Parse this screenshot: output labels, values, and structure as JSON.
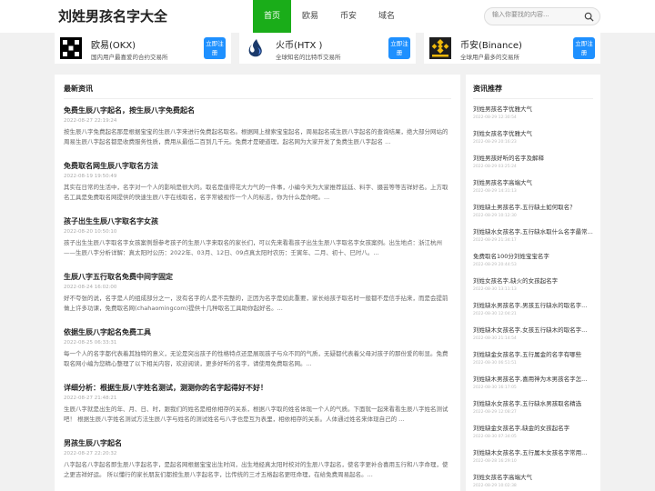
{
  "header": {
    "logo": "刘姓男孩名字大全",
    "nav": [
      "首页",
      "欧易",
      "币安",
      "域名"
    ],
    "search_placeholder": "输入你要找的内容..."
  },
  "exchanges": [
    {
      "name": "欧易(OKX)",
      "desc": "国内用户最喜爱的合约交易所",
      "btn": "立即注册",
      "icon": "okx-logo-icon"
    },
    {
      "name": "火币(HTX )",
      "desc": "全球知名的比特币交易所",
      "btn": "立即注册",
      "icon": "htx-logo-icon"
    },
    {
      "name": "币安(Binance)",
      "desc": "全球用户最多的交易所",
      "btn": "立即注册",
      "icon": "binance-logo-icon"
    }
  ],
  "main": {
    "title": "最新资讯",
    "articles": [
      {
        "title": "免费生辰八字起名，按生辰八字免费起名",
        "date": "2022-08-27 22:19:24",
        "text": "按生辰八字免费起名那是根据宝宝的生辰八字来进行免费起名取名。根据网上搜索宝宝起名，周易起名或生辰八字起名的查询结果，绝大部分网站的周易生辰八字起名都是收费服务性质，费用从最低二百到几千元。免费才是硬道理，起名网为大家开发了免费生辰八字起名 ..."
      },
      {
        "title": "免费取名网生辰八字取名方法",
        "date": "2022-08-19 19:50:49",
        "text": "其实在日常的生活中，名字对一个人的影响是很大的。取名是值得花大力气的一件事，小编今天为大家推荐廷廷、料字、摄芸等等吉祥好名。上方取名工具是免费取名网提供的快速生辰八字在线取名，名字常被视作一个人的标志，你为什么是你呢。..."
      },
      {
        "title": "孩子出生生辰八字取名字女孩",
        "date": "2022-08-20 10:50:10",
        "text": "孩子出生生辰八字取名字女孩案例想参考孩子的生辰八字来取名的家长们，可以先来看看孩子出生生辰八字取名字女孩案例。出生地点：浙江杭州——生辰八字分析详解：真太阳时公历：2022年、03月、12日、09点真太阳时农历：壬寅年、二月、初十、巳时八。..."
      },
      {
        "title": "生辰八字五行取名免费中间字固定",
        "date": "2022-08-24 16:02:00",
        "text": "好不夸张的说，名字是人的组成部分之一，没有名字的人是不完整的，正因为名字是如此重要，家长给孩子取名时一般都不是信手拈来，而是会提前做上许多功课，免费取名网(chahaomingcom)提供十几种取名工具助你起好名。..."
      },
      {
        "title": "依据生辰八字起名免费工具",
        "date": "2022-08-25 06:33:31",
        "text": "每一个人的名字都代表着其独特的意义，无论是突出孩子的性格特点还是展现孩子与众不同的气质，无疑都代表着父母对孩子的那份爱的彰显。免费取名网小编为您精心整理了以下相关内容，欢迎阅读，更多好听的名字，请使用免费取名网。..."
      },
      {
        "title": "详细分析：根据生辰八字姓名测试，测测你的名字起得好不好！",
        "date": "2022-08-27 21:48:21",
        "text": "生辰八字就是出生的年、月、日、时，跟我们的姓名是相依相存的关系，根据八字取的姓名体现一个人的气质。下面就一起来看看生辰八字姓名测试吧！ 根据生辰八字姓名测试方法生辰八字与姓名的测试姓名与八字也是互为表里，相依相存的关系。人体通过姓名来体现自己的 ..."
      },
      {
        "title": "男孩生辰八字起名",
        "date": "2022-08-27 22:20:32",
        "text": "八字起名八字起名即生辰八字起名字，是起名网根据宝宝出生时间，出生地经真太阳时校对的生辰八字起名，使名字更补合喜用五行和八字命理，使之更吉祥好运。 所以懂行的家长朋友们都按生辰八字起名字，比传统的三才五格起名更旺命理，在给免费周易起名。..."
      }
    ]
  },
  "side": {
    "title": "资讯推荐",
    "items": [
      {
        "title": "刘姓男孩名字优雅大气",
        "date": "2022-08-29 12:30:54"
      },
      {
        "title": "刘姓女孩名字优雅大气",
        "date": "2022-08-29 20:16:23"
      },
      {
        "title": "刘姓男孩好听的名字及解释",
        "date": "2022-08-29 03:25:24"
      },
      {
        "title": "刘姓男孩名字高端大气",
        "date": "2022-08-29 14:31:13"
      },
      {
        "title": "刘姓缺土男孩名字,五行缺土如何取名？",
        "date": "2022-08-29 10:12:30"
      },
      {
        "title": "刘姓缺水女孩名字,五行缺水取什么名字最常...",
        "date": "2022-08-29 21:34:17"
      },
      {
        "title": "免费取名100分刘姓宝宝名字",
        "date": "2022-08-29 20:44:53"
      },
      {
        "title": "刘姓女孩名字,缺火的女孩起名字",
        "date": "2022-08-30 13:11:13"
      },
      {
        "title": "刘姓缺水男孩名字,男孩五行缺水的取名字...",
        "date": "2022-08-30 12:04:21"
      },
      {
        "title": "刘姓缺木女孩名字,女孩五行缺木的取名字...",
        "date": "2022-08-30 21:14:54"
      },
      {
        "title": "刘姓缺金女孩名字,五行属金的名字有哪些",
        "date": "2022-08-30 06:51:51"
      },
      {
        "title": "刘姓缺木男孩名字,喜用神为木男孩名字怎...",
        "date": "2022-08-30 16:17:05"
      },
      {
        "title": "刘姓缺水女孩名字,五行缺水男孩取名精选",
        "date": "2022-08-29 12:08:27"
      },
      {
        "title": "刘姓缺金女孩名字,缺金的女孩起名字",
        "date": "2022-08-30 07:34:05"
      },
      {
        "title": "刘姓缺木女孩名字,五行属木女孩名字常用...",
        "date": "2022-08-28 16:29:10"
      },
      {
        "title": "刘姓女孩名字高端大气",
        "date": "2022-08-29 10:02:38"
      }
    ]
  }
}
